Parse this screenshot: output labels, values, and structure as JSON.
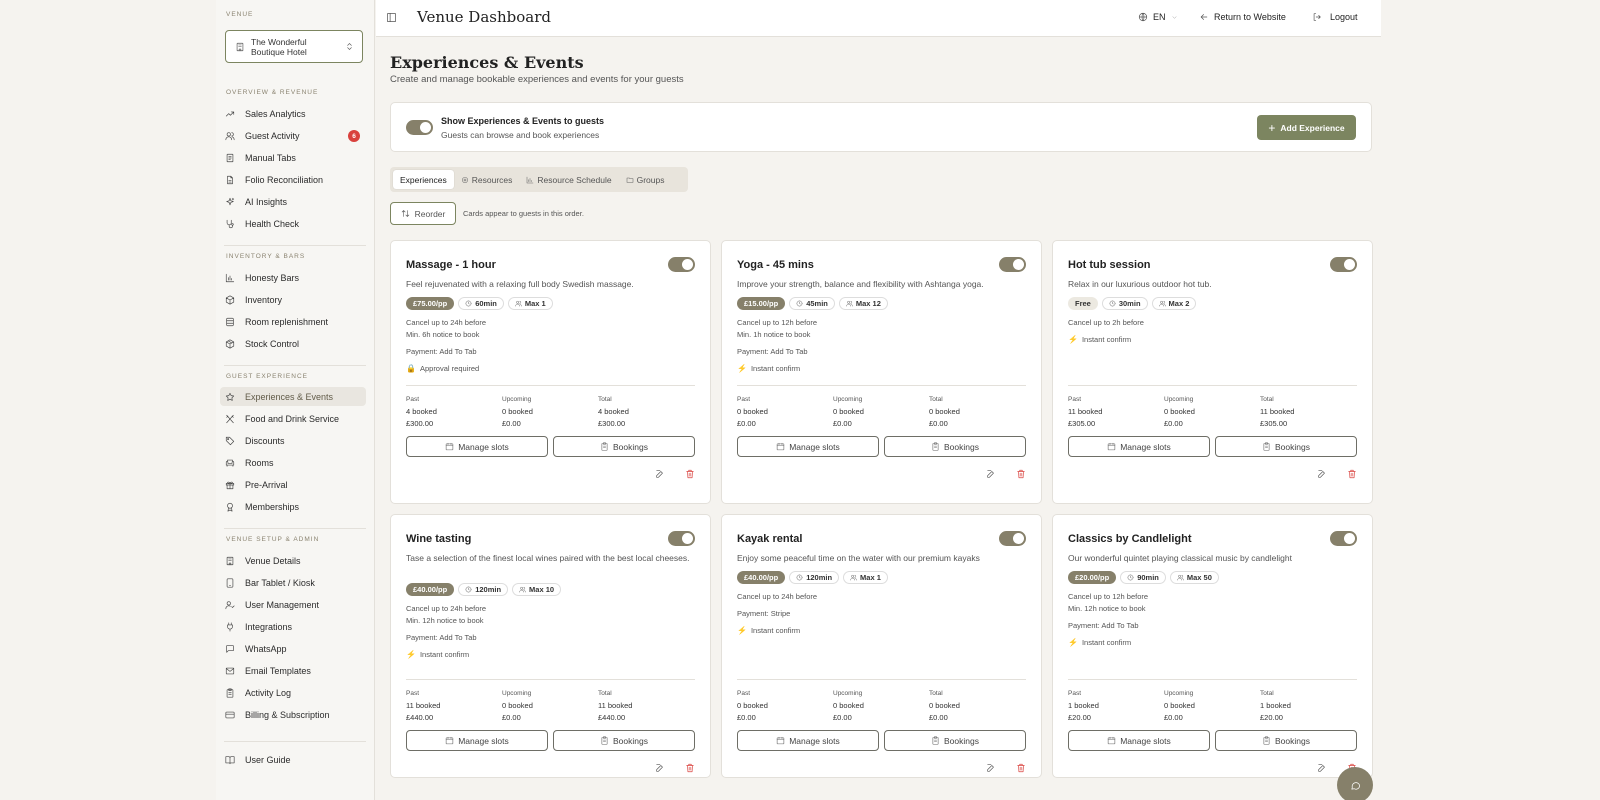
{
  "sidebar": {
    "venue_label": "VENUE",
    "venue_name": "The Wonderful Boutique Hotel",
    "sections": {
      "overview": "OVERVIEW & REVENUE",
      "inventory": "INVENTORY & BARS",
      "guest": "GUEST EXPERIENCE",
      "setup": "VENUE SETUP & ADMIN"
    },
    "items": {
      "sales_analytics": "Sales Analytics",
      "guest_activity": "Guest Activity",
      "guest_activity_badge": "6",
      "manual_tabs": "Manual Tabs",
      "folio_reconciliation": "Folio Reconciliation",
      "ai_insights": "AI Insights",
      "health_check": "Health Check",
      "honesty_bars": "Honesty Bars",
      "inventory": "Inventory",
      "room_replenishment": "Room replenishment",
      "stock_control": "Stock Control",
      "experiences_events": "Experiences & Events",
      "food_drink": "Food and Drink Service",
      "discounts": "Discounts",
      "rooms": "Rooms",
      "pre_arrival": "Pre-Arrival",
      "memberships": "Memberships",
      "venue_details": "Venue Details",
      "bar_tablet": "Bar Tablet / Kiosk",
      "user_management": "User Management",
      "integrations": "Integrations",
      "whatsapp": "WhatsApp",
      "email_templates": "Email Templates",
      "activity_log": "Activity Log",
      "billing": "Billing & Subscription",
      "user_guide": "User Guide"
    }
  },
  "header": {
    "title": "Venue Dashboard",
    "language": "EN",
    "return_label": "Return to Website",
    "logout_label": "Logout"
  },
  "page": {
    "title": "Experiences & Events",
    "subtitle": "Create and manage bookable experiences and events for your guests",
    "show_toggle_title": "Show Experiences & Events to guests",
    "show_toggle_sub": "Guests can browse and book experiences",
    "add_button": "Add Experience",
    "tabs": [
      "Experiences",
      "Resources",
      "Resource Schedule",
      "Groups"
    ],
    "reorder_label": "Reorder",
    "reorder_note": "Cards appear to guests in this order."
  },
  "labels": {
    "past": "Past",
    "upcoming": "Upcoming",
    "total": "Total",
    "manage_slots": "Manage slots",
    "bookings": "Bookings"
  },
  "cards": [
    {
      "title": "Massage - 1 hour",
      "desc": "Feel rejuvenated with a relaxing full body Swedish massage.",
      "price": "£75.00/pp",
      "duration": "60min",
      "max": "Max 1",
      "info": [
        "Cancel up to 24h before",
        "Min. 6h notice to book"
      ],
      "payment": "Payment: Add To Tab",
      "confirm": "Approval required",
      "past": [
        "4 booked",
        "£300.00"
      ],
      "upcoming": [
        "0 booked",
        "£0.00"
      ],
      "total": [
        "4 booked",
        "£300.00"
      ]
    },
    {
      "title": "Yoga - 45 mins",
      "desc": "Improve your strength, balance and flexibility with Ashtanga yoga.",
      "price": "£15.00/pp",
      "duration": "45min",
      "max": "Max 12",
      "info": [
        "Cancel up to 12h before",
        "Min. 1h notice to book"
      ],
      "payment": "Payment: Add To Tab",
      "confirm": "Instant confirm",
      "past": [
        "0 booked",
        "£0.00"
      ],
      "upcoming": [
        "0 booked",
        "£0.00"
      ],
      "total": [
        "0 booked",
        "£0.00"
      ]
    },
    {
      "title": "Hot tub session",
      "desc": "Relax in our luxurious outdoor hot tub.",
      "price": "Free",
      "duration": "30min",
      "max": "Max 2",
      "info": [
        "Cancel up to 2h before"
      ],
      "payment": "",
      "confirm": "Instant confirm",
      "past": [
        "11 booked",
        "£305.00"
      ],
      "upcoming": [
        "0 booked",
        "£0.00"
      ],
      "total": [
        "11 booked",
        "£305.00"
      ]
    },
    {
      "title": "Wine tasting",
      "desc": "Tase a selection of the finest local wines paired with the best local cheeses.",
      "price": "£40.00/pp",
      "duration": "120min",
      "max": "Max 10",
      "info": [
        "Cancel up to 24h before",
        "Min. 12h notice to book"
      ],
      "payment": "Payment: Add To Tab",
      "confirm": "Instant confirm",
      "past": [
        "11 booked",
        "£440.00"
      ],
      "upcoming": [
        "0 booked",
        "£0.00"
      ],
      "total": [
        "11 booked",
        "£440.00"
      ]
    },
    {
      "title": "Kayak rental",
      "desc": "Enjoy some peaceful time on the water with our premium kayaks",
      "price": "£40.00/pp",
      "duration": "120min",
      "max": "Max 1",
      "info": [
        "Cancel up to 24h before"
      ],
      "payment": "Payment: Stripe",
      "confirm": "Instant confirm",
      "past": [
        "0 booked",
        "£0.00"
      ],
      "upcoming": [
        "0 booked",
        "£0.00"
      ],
      "total": [
        "0 booked",
        "£0.00"
      ]
    },
    {
      "title": "Classics by Candlelight",
      "desc": "Our wonderful quintet playing classical music by candlelight",
      "price": "£20.00/pp",
      "duration": "90min",
      "max": "Max 50",
      "info": [
        "Cancel up to 12h before",
        "Min. 12h notice to book"
      ],
      "payment": "Payment: Add To Tab",
      "confirm": "Instant confirm",
      "past": [
        "1 booked",
        "£20.00"
      ],
      "upcoming": [
        "0 booked",
        "£0.00"
      ],
      "total": [
        "1 booked",
        "£20.00"
      ]
    }
  ],
  "colors": {
    "accent": "#7c8560",
    "toggle": "#86806a",
    "danger": "#d9413d"
  },
  "icons": {
    "nav": [
      "trending-up-icon",
      "users-icon",
      "receipt-icon",
      "file-icon",
      "sparkle-icon",
      "stethoscope-icon",
      "bar-chart-icon",
      "box-icon",
      "bed-icon",
      "package-icon",
      "star-icon",
      "utensils-icon",
      "tag-icon",
      "sofa-icon",
      "gift-icon",
      "award-icon",
      "building-icon",
      "tablet-icon",
      "user-cog-icon",
      "plug-icon",
      "message-icon",
      "mail-icon",
      "clipboard-icon",
      "credit-card-icon",
      "book-icon"
    ]
  }
}
